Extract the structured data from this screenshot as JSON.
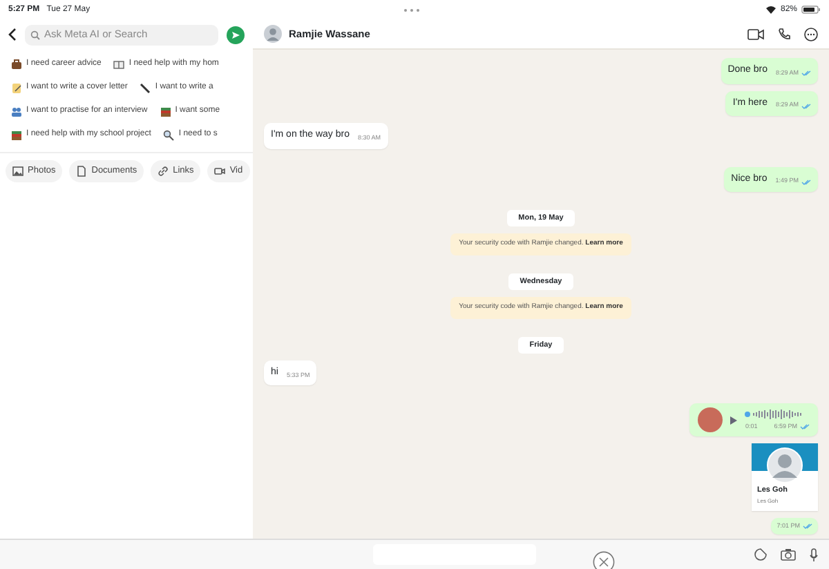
{
  "status_bar": {
    "time": "5:27 PM",
    "date": "Tue 27 May",
    "battery": "82%"
  },
  "search": {
    "placeholder": "Ask Meta AI or Search"
  },
  "suggestions": [
    {
      "kind": "briefcase",
      "label": "I need career advice"
    },
    {
      "kind": "book",
      "label": "I need help with my hom"
    },
    {
      "kind": "note",
      "label": "I want to write a cover letter"
    },
    {
      "kind": "pen",
      "label": "I want to write a"
    },
    {
      "kind": "people",
      "label": "I want to practise for an interview"
    },
    {
      "kind": "books",
      "label": "I want some"
    },
    {
      "kind": "books",
      "label": "I need help with my school project"
    },
    {
      "kind": "search",
      "label": "I need to s"
    }
  ],
  "filters": [
    {
      "kind": "photo",
      "label": "Photos"
    },
    {
      "kind": "doc",
      "label": "Documents"
    },
    {
      "kind": "link",
      "label": "Links"
    },
    {
      "kind": "video",
      "label": "Vid"
    }
  ],
  "chat": {
    "name": "Ramjie Wassane"
  },
  "messages": [
    {
      "kind": "text",
      "outgoing": true,
      "text": "Done bro",
      "time": "8:29 AM",
      "read": true
    },
    {
      "kind": "text",
      "outgoing": true,
      "text": "I'm here",
      "time": "8:29 AM",
      "read": true
    },
    {
      "kind": "text",
      "outgoing": false,
      "text": "I'm on the way bro",
      "time": "8:30 AM"
    },
    {
      "kind": "text",
      "outgoing": true,
      "text": "Nice bro",
      "time": "1:49 PM",
      "read": true
    },
    {
      "kind": "date",
      "text": "Mon, 19 May"
    },
    {
      "kind": "system",
      "text": "Your security code with Ramjie changed.",
      "link": "Learn more"
    },
    {
      "kind": "date",
      "text": "Wednesday"
    },
    {
      "kind": "system",
      "text": "Your security code with Ramjie changed.",
      "link": "Learn more"
    },
    {
      "kind": "date",
      "text": "Friday"
    },
    {
      "kind": "text",
      "outgoing": false,
      "text": "hi",
      "time": "5:33 PM"
    },
    {
      "kind": "voice",
      "outgoing": true,
      "duration": "0:01",
      "time": "6:59 PM",
      "read": true
    },
    {
      "kind": "contact",
      "name": "Les Goh",
      "subtitle": "Les Goh"
    },
    {
      "kind": "time",
      "outgoing": true,
      "time": "7:01 PM",
      "read": true
    }
  ]
}
